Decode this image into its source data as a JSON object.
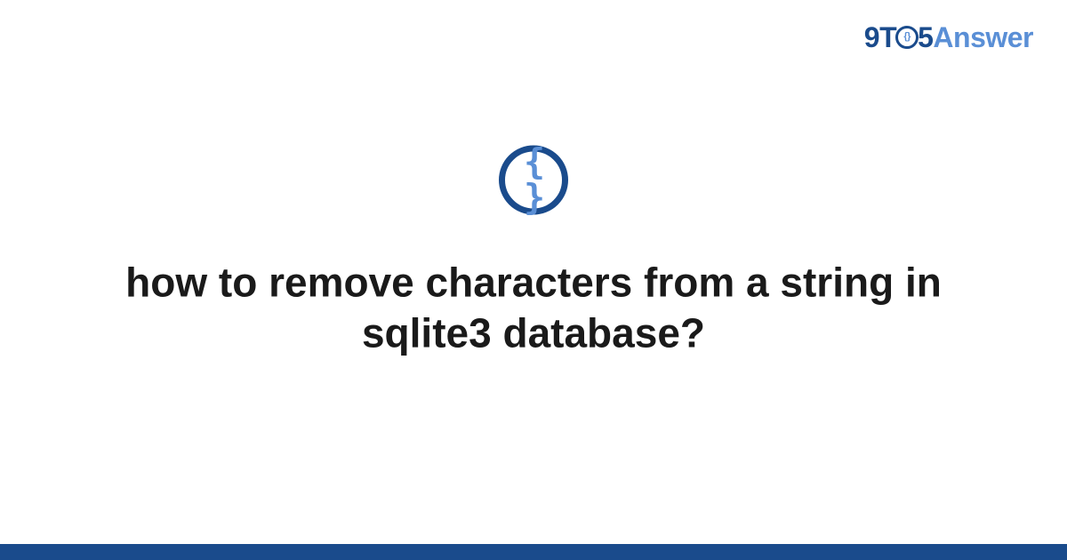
{
  "logo": {
    "part1": "9T",
    "part2_inner": "{}",
    "part3": "5",
    "part4": "Answer"
  },
  "icon": {
    "braces": "{ }"
  },
  "question": {
    "title": "how to remove characters from a string in sqlite3 database?"
  }
}
